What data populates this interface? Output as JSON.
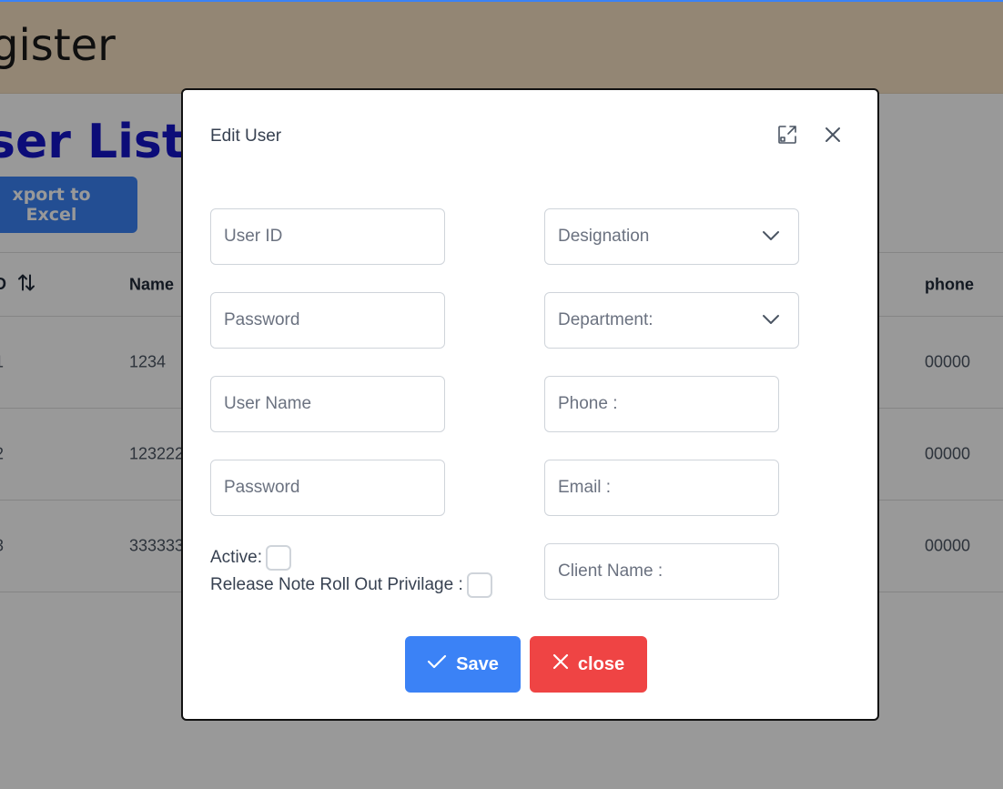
{
  "page": {
    "title": "gister",
    "list_title": "ser List",
    "export_label": "xport to Excel"
  },
  "table": {
    "headers": {
      "id": "D",
      "name": "Name",
      "phone": "phone"
    },
    "rows": [
      {
        "id": "1",
        "name": "1234",
        "phone": "00000"
      },
      {
        "id": "2",
        "name": "123222",
        "phone": "00000"
      },
      {
        "id": "3",
        "name": "333333",
        "phone": "00000"
      }
    ]
  },
  "modal": {
    "title": "Edit User",
    "fields": {
      "user_id": {
        "placeholder": "User ID"
      },
      "password": {
        "placeholder": "Password"
      },
      "user_name": {
        "placeholder": "User Name"
      },
      "password_confirm": {
        "placeholder": "Password"
      },
      "designation": {
        "value": "Designation"
      },
      "department": {
        "value": "Department:"
      },
      "phone": {
        "placeholder": "Phone :"
      },
      "email": {
        "placeholder": "Email :"
      },
      "client_name": {
        "placeholder": "Client Name :"
      }
    },
    "active_label": "Active:",
    "release_label": "Release Note Roll Out Privilage :",
    "save_label": "Save",
    "close_label": "close"
  },
  "colors": {
    "primary": "#3b82f6",
    "danger": "#ef4444",
    "header_bg": "#f5dfc2",
    "list_title": "#1515c8"
  }
}
